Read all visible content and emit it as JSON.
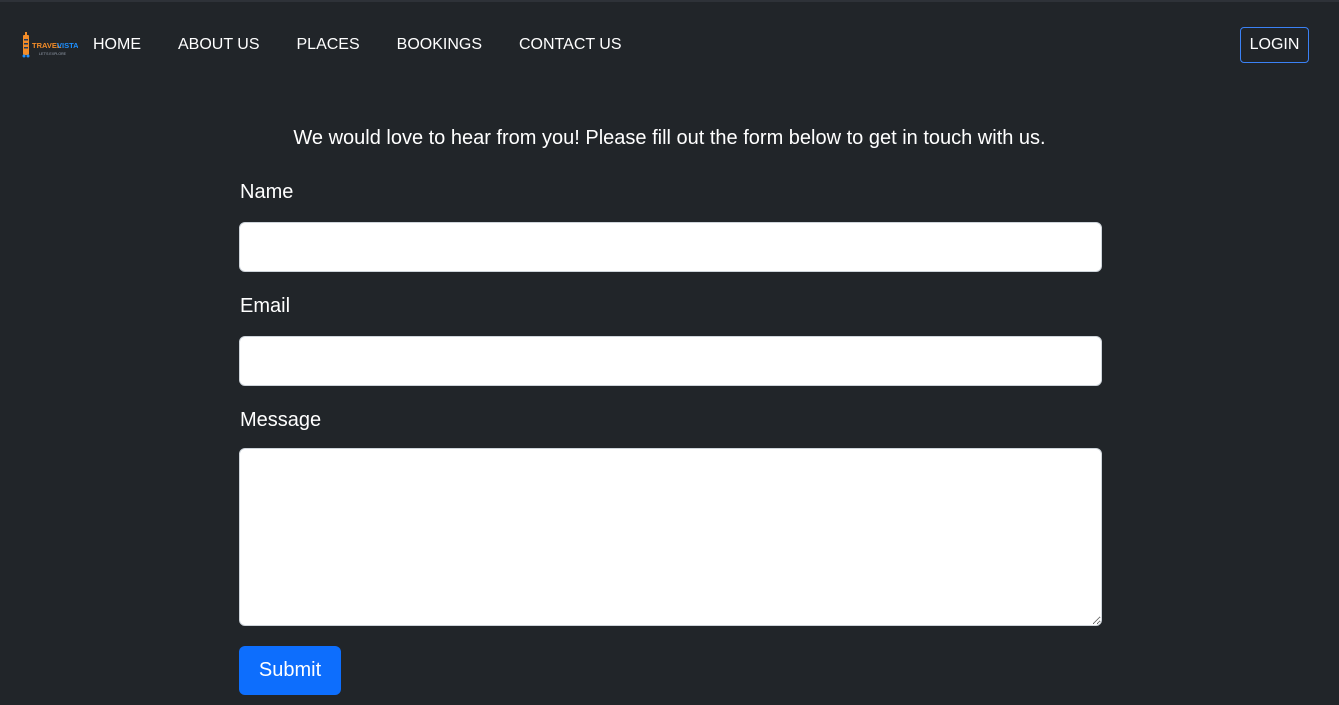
{
  "brand": {
    "logo_text": "TRAVEL VISTA",
    "logo_tagline": "LET'S EXPLORE",
    "colors": {
      "primary": "#f28c28",
      "secondary": "#1e90ff"
    }
  },
  "nav": {
    "items": [
      {
        "label": "HOME"
      },
      {
        "label": "ABOUT US"
      },
      {
        "label": "PLACES"
      },
      {
        "label": "BOOKINGS"
      },
      {
        "label": "CONTACT US"
      }
    ],
    "login_label": "LOGIN"
  },
  "contact": {
    "intro": "We would love to hear from you! Please fill out the form below to get in touch with us.",
    "fields": {
      "name_label": "Name",
      "name_value": "",
      "email_label": "Email",
      "email_value": "",
      "message_label": "Message",
      "message_value": ""
    },
    "submit_label": "Submit"
  },
  "theme": {
    "background": "#212529",
    "accent": "#0d6efd",
    "login_border": "#3b82f6"
  }
}
